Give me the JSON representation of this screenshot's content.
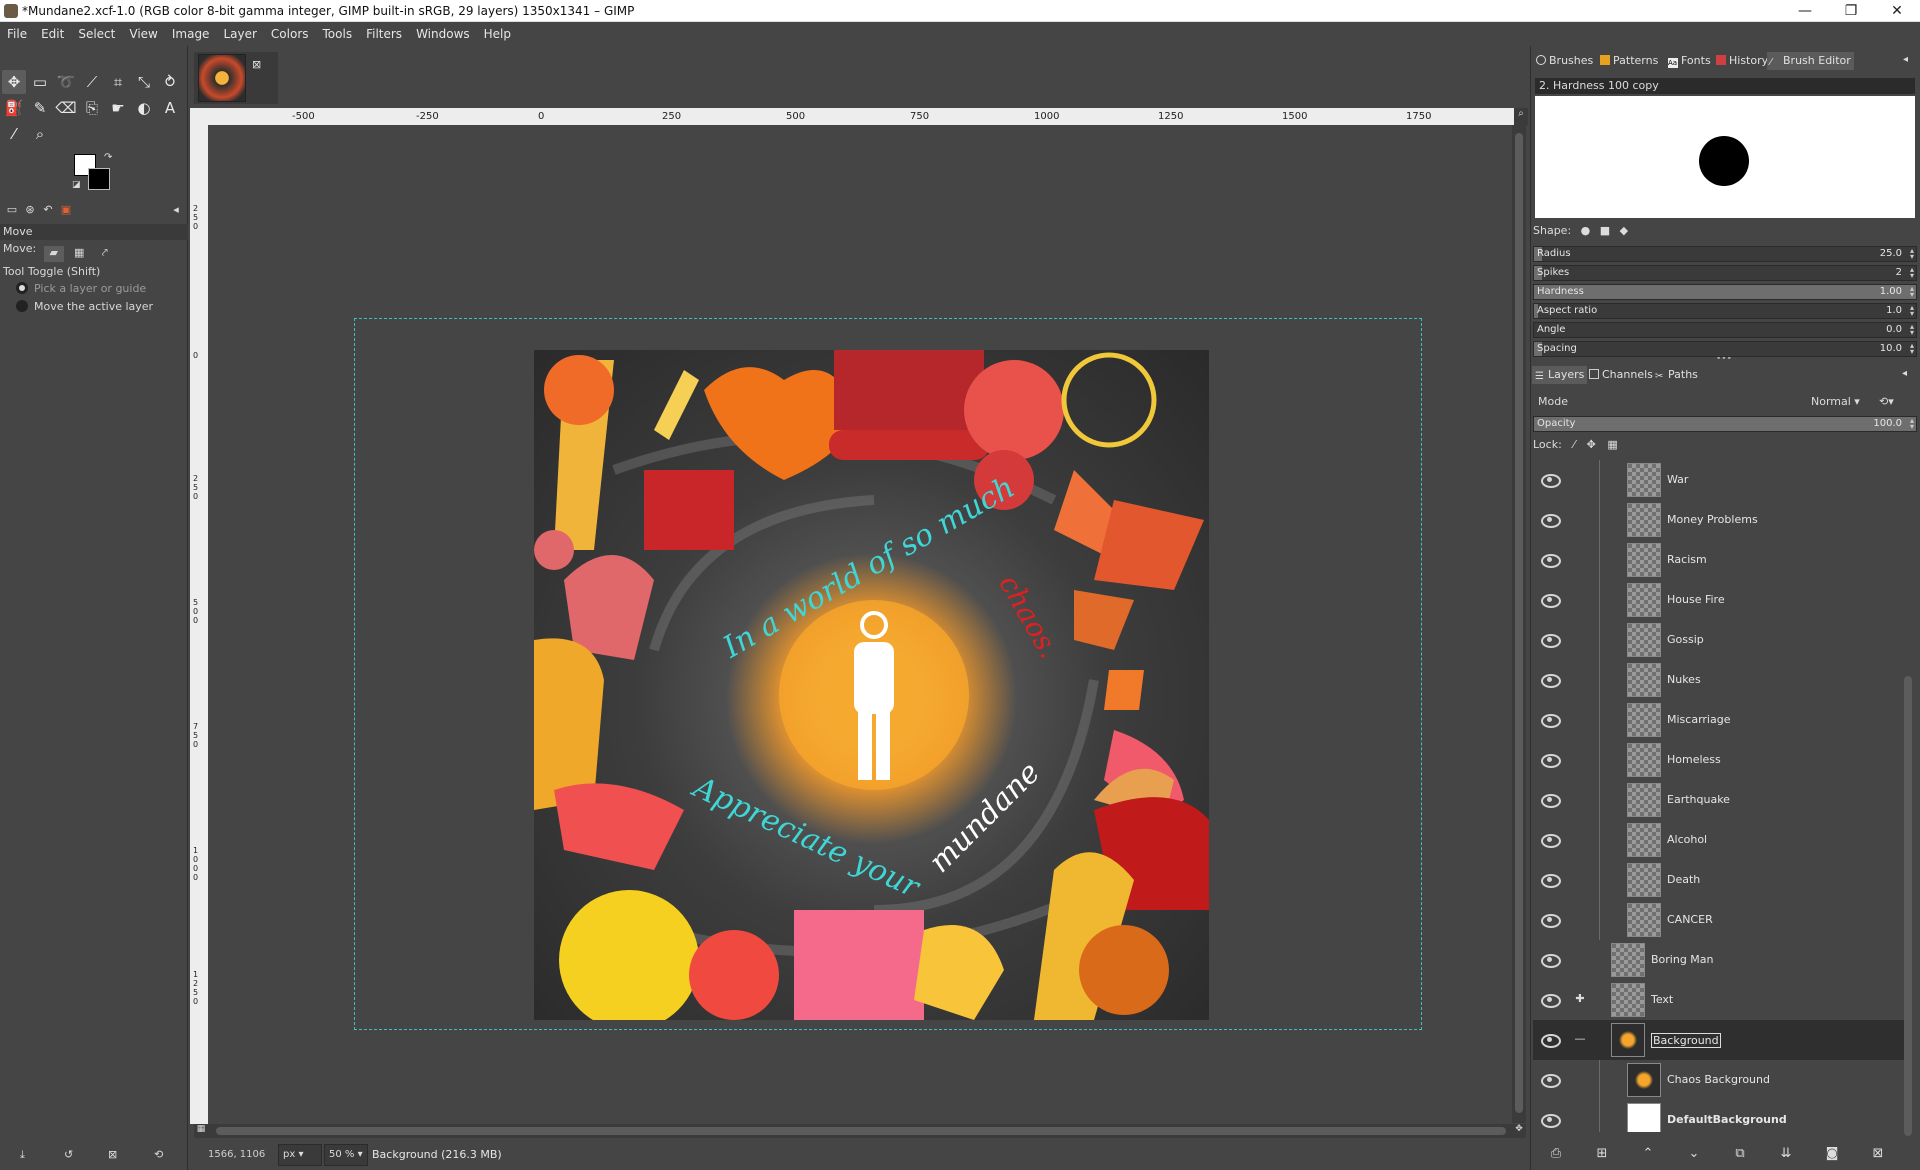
{
  "window": {
    "title": "*Mundane2.xcf-1.0 (RGB color 8-bit gamma integer, GIMP built-in sRGB, 29 layers) 1350x1341 – GIMP",
    "minimize": "—",
    "restore": "❐",
    "close": "✕"
  },
  "menu": [
    "File",
    "Edit",
    "Select",
    "View",
    "Image",
    "Layer",
    "Colors",
    "Tools",
    "Filters",
    "Windows",
    "Help"
  ],
  "toolbox": {
    "options_title": "Move",
    "move_label": "Move:",
    "tool_toggle": "Tool Toggle  (Shift)",
    "option_pick": "Pick a layer or guide",
    "option_move": "Move the active layer",
    "fg_color": "#ffffff",
    "bg_color": "#000000"
  },
  "ruler": {
    "h_labels": [
      "-500",
      "-250",
      "0",
      "250",
      "500",
      "750",
      "1000",
      "1250",
      "1500",
      "1750"
    ],
    "v_labels": [
      "2 5 0",
      "0",
      "2 5 0",
      "5 0 0",
      "7 5 0",
      "1 0 0 0",
      "1 2 5 0"
    ]
  },
  "artwork": {
    "top_text": "In a world of so much",
    "top_accent": "chaos.",
    "bottom_text": "Appreciate your",
    "bottom_accent": "mundane"
  },
  "status": {
    "coords": "1566, 1106",
    "unit": "px",
    "zoom": "50 %",
    "layer_info": "Background (216.3 MB)"
  },
  "dock_top": {
    "tabs": [
      "Brushes",
      "Patterns",
      "Fonts",
      "History",
      "Brush Editor"
    ],
    "brush_name": "2. Hardness 100 copy",
    "shape_label": "Shape:",
    "sliders": [
      {
        "label": "Radius",
        "value": "25.0",
        "fill": 0.02
      },
      {
        "label": "Spikes",
        "value": "2",
        "fill": 0.02
      },
      {
        "label": "Hardness",
        "value": "1.00",
        "fill": 1.0
      },
      {
        "label": "Aspect ratio",
        "value": "1.0",
        "fill": 0.01
      },
      {
        "label": "Angle",
        "value": "0.0",
        "fill": 0.0
      },
      {
        "label": "Spacing",
        "value": "10.0",
        "fill": 0.02
      }
    ]
  },
  "dock_layers": {
    "tabs": [
      "Layers",
      "Channels",
      "Paths"
    ],
    "mode_label": "Mode",
    "mode_value": "Normal",
    "opacity_label": "Opacity",
    "opacity_value": "100.0",
    "opacity_fill": 1.0,
    "lock_label": "Lock:",
    "layers": [
      {
        "name": "War",
        "level": 2
      },
      {
        "name": "Money Problems",
        "level": 2
      },
      {
        "name": "Racism",
        "level": 2
      },
      {
        "name": "House Fire",
        "level": 2
      },
      {
        "name": "Gossip",
        "level": 2
      },
      {
        "name": "Nukes",
        "level": 2
      },
      {
        "name": "Miscarriage",
        "level": 2
      },
      {
        "name": "Homeless",
        "level": 2
      },
      {
        "name": "Earthquake",
        "level": 2
      },
      {
        "name": "Alcohol",
        "level": 2
      },
      {
        "name": "Death",
        "level": 2
      },
      {
        "name": "CANCER",
        "level": 2
      },
      {
        "name": "Boring Man",
        "level": 1
      },
      {
        "name": "Text",
        "level": 1
      },
      {
        "name": "Background",
        "level": 1
      },
      {
        "name": "Chaos Background",
        "level": 2
      },
      {
        "name": "DefaultBackground",
        "level": 2
      }
    ]
  }
}
